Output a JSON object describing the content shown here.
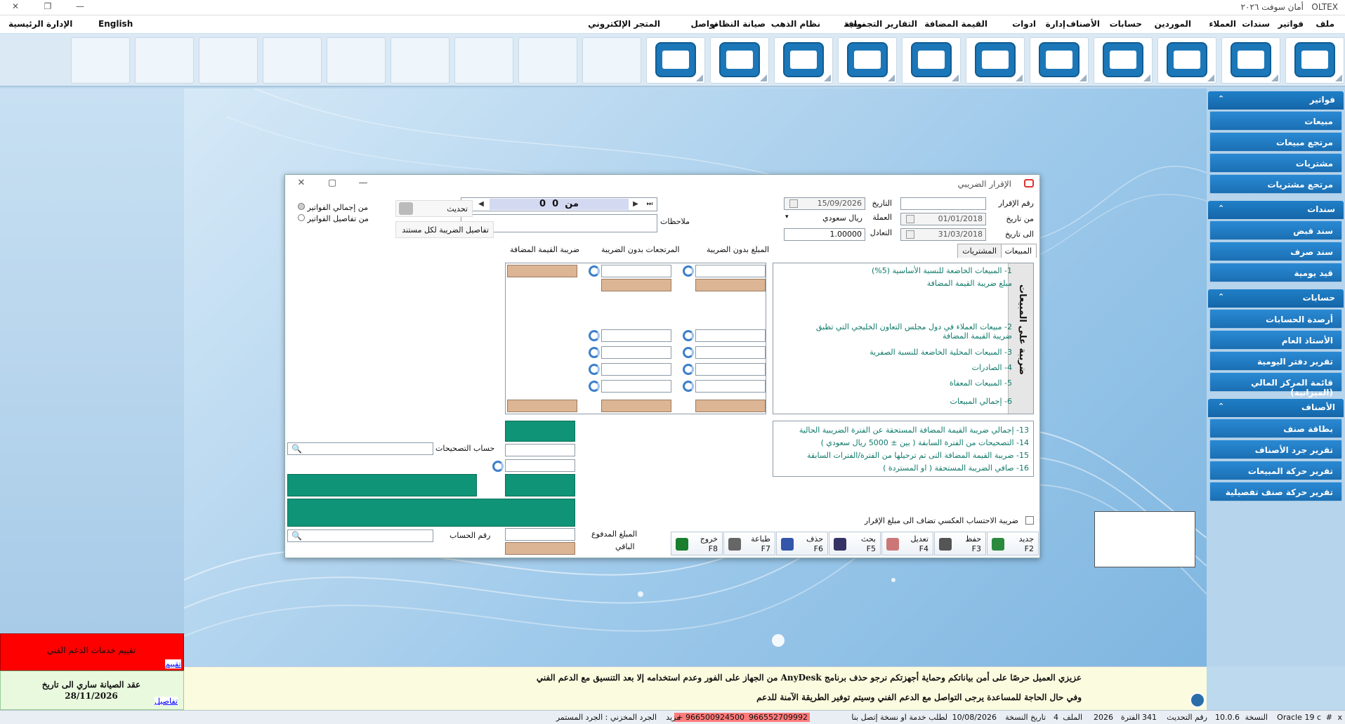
{
  "window": {
    "app_name": "أمان سوفت ٢٠٢٦",
    "brand": "OLTEX"
  },
  "menu": [
    "ملف",
    "فواتير",
    "سندات",
    "العملاء",
    "الموردين",
    "حسابات",
    "الأصناف",
    "إدارة",
    "ادوات",
    "القيمة المضافة",
    "التقارير التجميعية",
    "نوافذ",
    "نظام الذهب",
    "صيانة النظام",
    "تواصل",
    "المتجر الإلكتروني"
  ],
  "menu_left": {
    "english": "English",
    "home": "الإدارة الرئيسية"
  },
  "sidebar": {
    "groups": [
      {
        "title": "فواتير",
        "items": [
          "مبيعات",
          "مرتجع مبيعات",
          "مشتريات",
          "مرتجع مشتريات"
        ]
      },
      {
        "title": "سندات",
        "items": [
          "سند قبض",
          "سند صرف",
          "قيد يومية"
        ]
      },
      {
        "title": "حسابات",
        "items": [
          "أرصدة الحسابات",
          "الأستاذ العام",
          "تقرير دفتر اليومية",
          "قائمة المركز المالي (الميزانية)"
        ]
      },
      {
        "title": "الأصناف",
        "items": [
          "بطاقة صنف",
          "تقرير جرد  الأصناف",
          "تقرير حركة المبيعات",
          "تقرير حركة  صنف تفصيلية"
        ]
      }
    ]
  },
  "dialog": {
    "title": "الإقرار الضريبي",
    "labels": {
      "decl_no": "رقم الإقرار",
      "from_date": "من تاريخ",
      "to_date": "الى تاريخ",
      "date": "التاريخ",
      "currency": "العملة",
      "rate": "التعادل",
      "notes": "ملاحظات",
      "refresh": "تحديث",
      "tax_details": "تفاصيل الضريبة لكل مستند",
      "radio_total": "من إجمالي الفواتير",
      "radio_details": "من تفاصيل الفواتير"
    },
    "values": {
      "date": "15/09/2026",
      "from_date": "01/01/2018",
      "to_date": "31/03/2018",
      "currency": "ريال سعودي",
      "rate": "1.00000"
    },
    "pager": {
      "current": "0",
      "of": "من",
      "total": "0"
    },
    "tabs": [
      "المبيعات",
      "المشتريات"
    ],
    "col_headers": [
      "المبلغ بدون الضريبة",
      "المرتجعات بدون الضريبة",
      "ضريبة القيمة المضافة"
    ],
    "vertical_label": "ضريبة على المبيعات",
    "rows": [
      "1- المبيعات الخاضعة للنسبة الأساسية (5%)",
      "مبلغ ضريبة القيمة المضافة",
      "2- مبيعات العملاء في دول مجلس التعاون الخليجي التي تطبق ضريبة القيمة المضافة",
      "3- المبيعات المحلية الخاضعة  للنسبة الصفرية",
      "4- الصادرات",
      "5- المبيعات المعفاة",
      "6- إجمالي المبيعات"
    ],
    "summary_rows": [
      "13- إجمالي ضريبة القيمة المضافة المستحقة عن الفترة الضريبية الحالية",
      "14- التصحيحات من الفترة السابقة ( بين ± 5000 ريال سعودي )",
      "15- ضريبة القيمة المضافة التى تم ترحيلها من الفترة/الفترات السابقة",
      "16- صافي الضريبة المستحقة ( او المستردة )"
    ],
    "corrections_account": "حساب التصحيحات",
    "account_no": "رقم الحساب",
    "paid": "المبلغ المدفوع",
    "remaining": "الباقي",
    "reverse_tax": "ضريبة الاحتساب العكسي تضاف الى مبلغ الإقرار",
    "buttons": [
      {
        "label": "جديد",
        "key": "F2"
      },
      {
        "label": "حفظ",
        "key": "F3"
      },
      {
        "label": "تعديل",
        "key": "F4"
      },
      {
        "label": "بحث",
        "key": "F5"
      },
      {
        "label": "حذف",
        "key": "F6"
      },
      {
        "label": "طباعة",
        "key": "F7"
      },
      {
        "label": "خروج",
        "key": "F8"
      }
    ]
  },
  "notice": {
    "line1": "عزيزي العميل حرصًا على أمن بياناتكم وحماية أجهزتكم نرجو حذف برنامج AnyDesk من الجهاز على الفور وعدم استخدامه إلا بعد التنسيق مع الدعم الفني",
    "line2": "وفي حال الحاجة للمساعدة يرجى التواصل مع الدعم الفني وسيتم توفير الطريقة الآمنة للدعم"
  },
  "support": {
    "rate_title": "تقييم خدمات الدعم الفني",
    "rate_link": "تقييم",
    "maint_title": "عقد الصيانة ساري الى  تاريخ",
    "maint_date": "28/11/2026",
    "details_link": "تفاصيل"
  },
  "status": {
    "db": "Oracle 19 c",
    "hash": "#",
    "x": "x",
    "version_label": "النسخة",
    "version": "10.0.6",
    "update_label": "رقم التحديث",
    "update": "341",
    "period_label": "الفترة",
    "period": "2026",
    "file_label": "الملف",
    "file": "4",
    "copy_date_label": "تاريخ النسخة",
    "copy_date": "10/08/2026",
    "service": "لطلب خدمة او نسخة إتصل بنا",
    "phone1": "966552709992 +",
    "phone2": "966500924500 +",
    "more": "مزيد",
    "inventory": "الجرد المخزني : الجرد المستمر"
  },
  "colors": {
    "accent": "#1b6fb3",
    "tan": "#dcb595",
    "green": "#0f9477",
    "red": "#ff0000"
  }
}
